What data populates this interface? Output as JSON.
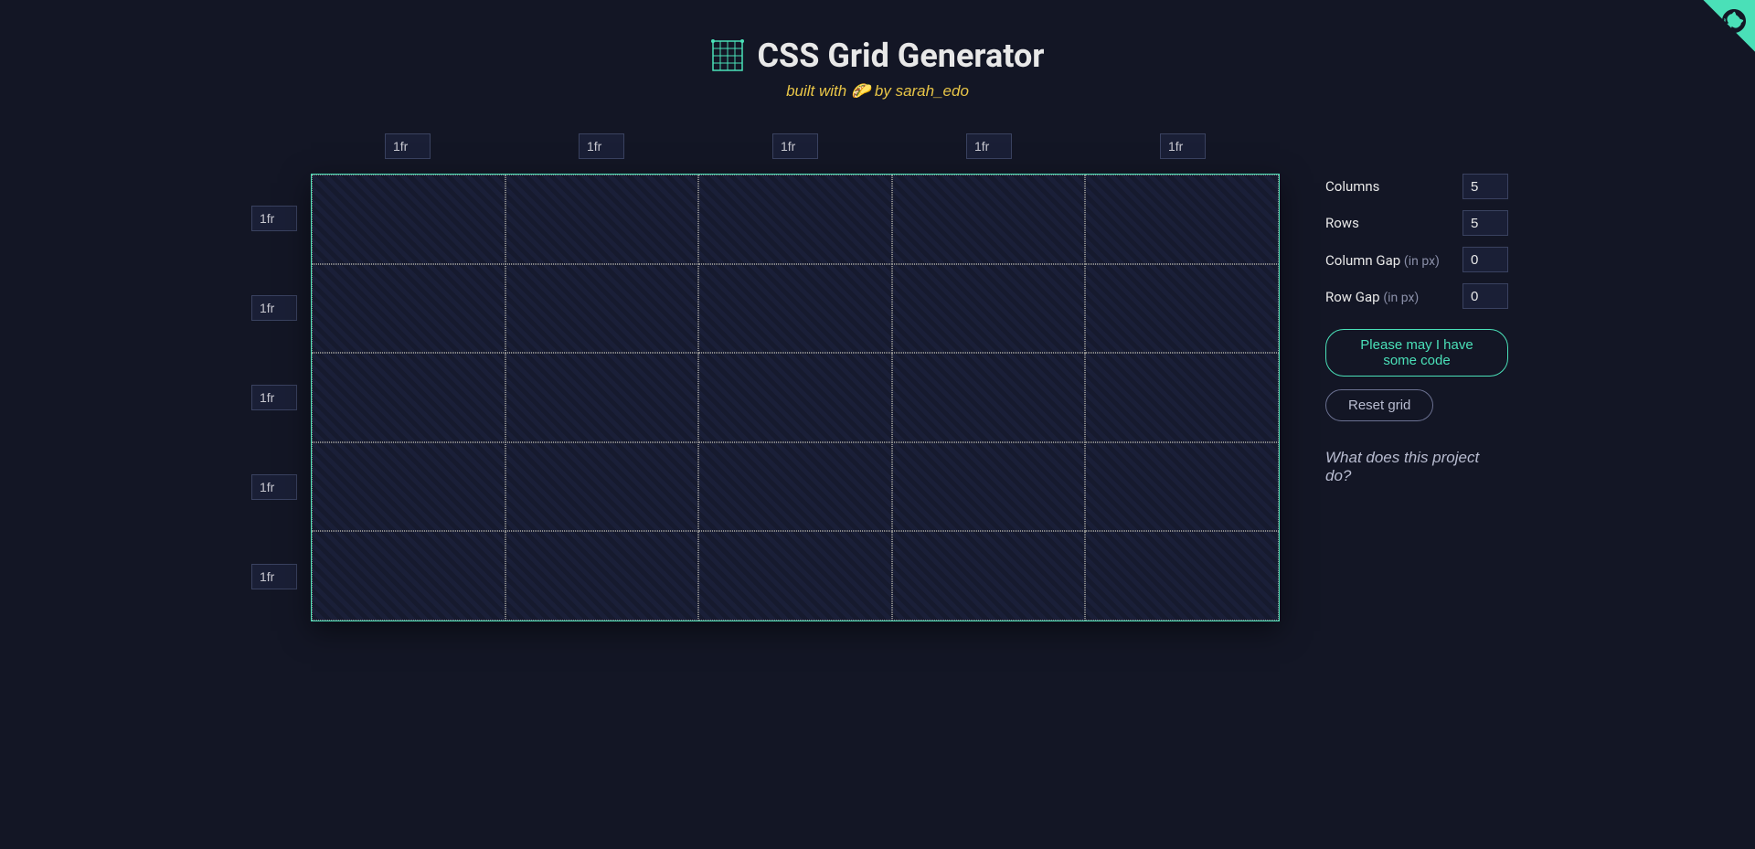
{
  "header": {
    "title": "CSS Grid Generator",
    "subtitle_prefix": "built with ",
    "subtitle_emoji": "🌮",
    "subtitle_by": " by ",
    "subtitle_author": "sarah_edo"
  },
  "columns": [
    "1fr",
    "1fr",
    "1fr",
    "1fr",
    "1fr"
  ],
  "rows": [
    "1fr",
    "1fr",
    "1fr",
    "1fr",
    "1fr"
  ],
  "controls": {
    "columns": {
      "label": "Columns",
      "value": "5"
    },
    "rows": {
      "label": "Rows",
      "value": "5"
    },
    "colgap": {
      "label": "Column Gap ",
      "hint": "(in px)",
      "value": "0"
    },
    "rowgap": {
      "label": "Row Gap ",
      "hint": "(in px)",
      "value": "0"
    },
    "generate_button": "Please may I have some code",
    "reset_button": "Reset grid",
    "help_link": "What does this project do?"
  }
}
